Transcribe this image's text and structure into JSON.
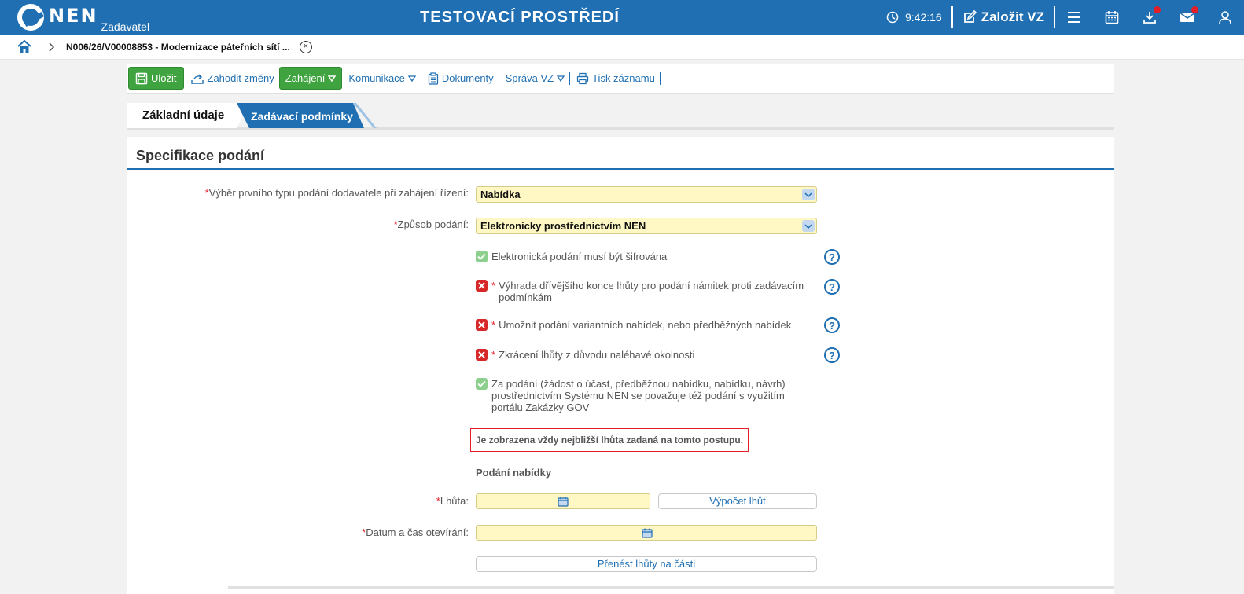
{
  "header": {
    "logo_text": "NEN",
    "logo_sub": "Zadavatel",
    "env_title": "TESTOVACÍ PROSTŘEDÍ",
    "time": "9:42:16",
    "create_label": "Založit VZ"
  },
  "breadcrumb": {
    "text": "N006/26/V00008853 - Modernizace páteřních sítí ..."
  },
  "toolbar": {
    "save_label": "Uložit",
    "discard_label": "Zahodit změny",
    "start_label": "Zahájení",
    "communication_label": "Komunikace",
    "documents_label": "Dokumenty",
    "manage_label": "Správa VZ",
    "print_label": "Tisk záznamu"
  },
  "tabs": {
    "basic": "Základní údaje",
    "conditions": "Zadávací podmínky"
  },
  "section": {
    "title": "Specifikace podání",
    "first_type_label": "Výběr prvního typu podání dodavatele při zahájení řízení:",
    "first_type_value": "Nabídka",
    "method_label": "Způsob podání:",
    "method_value": "Elektronicky prostřednictvím NEN",
    "checks": [
      {
        "text": "Elektronická podání musí být šifrována",
        "required": ""
      },
      {
        "text": "Výhrada dřívějšího konce lhůty pro podání námitek proti zadávacím podmínkám",
        "required": "*"
      },
      {
        "text": "Umožnit podání variantních nabídek, nebo předběžných nabídek",
        "required": "*"
      },
      {
        "text": "Zkrácení lhůty z důvodu naléhavé okolnosti",
        "required": "*"
      },
      {
        "text": "Za podání (žádost o účast, předběžnou nabídku, nabídku, návrh) prostřednictvím Systému NEN se považuje též podání s využitím portálu Zakázky GOV",
        "required": ""
      }
    ],
    "notice": "Je zobrazena vždy nejbližší lhůta zadaná na tomto postupu.",
    "subhead": "Podání nabídky",
    "deadline_label": "Lhůta:",
    "calc_button": "Výpočet lhůt",
    "opening_label": "Datum a čas otevírání:",
    "transfer_button": "Přenést lhůty na části",
    "help_symbol": "?"
  },
  "colors": {
    "primary": "#1f6fb2",
    "green": "#3fa43f",
    "error": "#d62828",
    "field": "#fff8c4"
  }
}
